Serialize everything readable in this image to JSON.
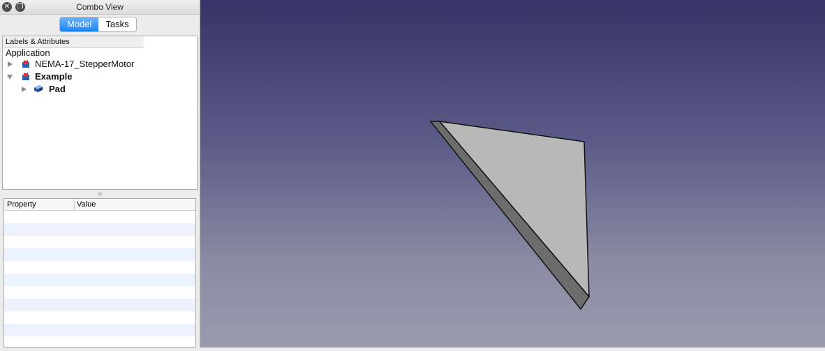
{
  "window": {
    "title": "Combo View"
  },
  "tabs": [
    {
      "label": "Model",
      "active": true
    },
    {
      "label": "Tasks",
      "active": false
    }
  ],
  "tree": {
    "header": "Labels & Attributes",
    "root": "Application",
    "items": [
      {
        "label": "NEMA-17_StepperMotor",
        "bold": false,
        "expanded": false,
        "icon": "document-icon"
      },
      {
        "label": "Example",
        "bold": true,
        "expanded": true,
        "icon": "document-icon"
      },
      {
        "label": "Pad",
        "bold": true,
        "expanded": false,
        "icon": "pad-feature-icon"
      }
    ]
  },
  "properties": {
    "columns": [
      "Property",
      "Value"
    ]
  },
  "colors": {
    "active_tab": "#1a82f7",
    "viewport_top": "#363468",
    "viewport_bottom": "#9a9aae",
    "shape_face": "#b8b8b8",
    "shape_side": "#6c6c6c"
  }
}
